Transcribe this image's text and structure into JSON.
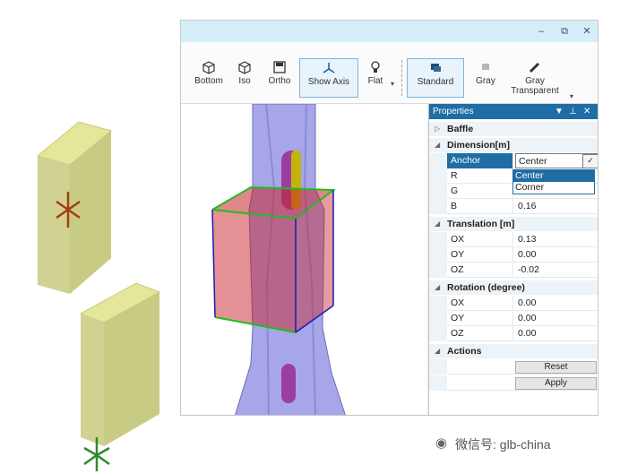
{
  "window": {
    "controls": [
      "–",
      "⧉",
      "✕"
    ]
  },
  "toolbar": {
    "items": [
      {
        "label": "Bottom",
        "icon": "cube-bottom-icon"
      },
      {
        "label": "Iso",
        "icon": "cube-iso-icon"
      },
      {
        "label": "Ortho",
        "icon": "cube-ortho-icon"
      },
      {
        "label": "Show Axis",
        "icon": "axis-icon"
      },
      {
        "label": "Flat",
        "icon": "bulb-icon"
      }
    ],
    "render_modes": [
      {
        "label": "Standard",
        "icon": "standard-render-icon"
      },
      {
        "label": "Gray",
        "icon": "gray-render-icon"
      },
      {
        "label": "Gray\nTransparent",
        "icon": "gray-transparent-icon"
      }
    ],
    "gray_transparent_line1": "Gray",
    "gray_transparent_line2": "Transparent"
  },
  "properties": {
    "title": "Properties",
    "object": "Baffle",
    "dimension": {
      "label": "Dimension[m]",
      "anchor_label": "Anchor",
      "anchor_value": "Center",
      "anchor_options": [
        "Center",
        "Corner"
      ],
      "r_label": "R",
      "g_label": "G",
      "b_label": "B",
      "b_value": "0.16"
    },
    "translation": {
      "label": "Translation [m]",
      "ox_label": "OX",
      "ox_value": "0.13",
      "oy_label": "OY",
      "oy_value": "0.00",
      "oz_label": "OZ",
      "oz_value": "-0.02"
    },
    "rotation": {
      "label": "Rotation (degree)",
      "ox_label": "OX",
      "ox_value": "0.00",
      "oy_label": "OY",
      "oy_value": "0.00",
      "oz_label": "OZ",
      "oz_value": "0.00"
    },
    "actions": {
      "label": "Actions",
      "reset": "Reset",
      "apply": "Apply"
    }
  },
  "watermark": "微信号: glb-china",
  "colors": {
    "panel_header": "#1e6ea5",
    "titlebar": "#d6eef7",
    "baffle_fill": "#d6d99a",
    "baffle_top": "#e6e88e",
    "tube": "#a7a6e8",
    "box_red": "#c9242c"
  }
}
